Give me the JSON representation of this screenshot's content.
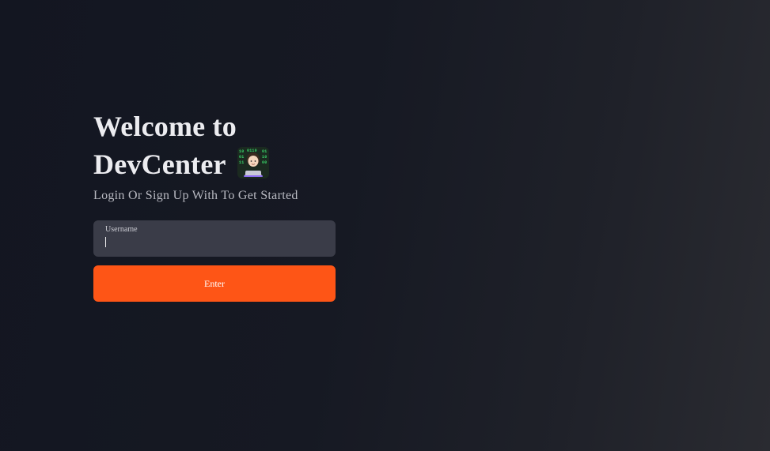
{
  "hero": {
    "title_line1": "Welcome to",
    "title_line2": "DevCenter",
    "title_icon": "technologist-emoji-icon",
    "subtitle": "Login Or Sign Up With To Get Started"
  },
  "form": {
    "username_label": "Username",
    "username_value": "",
    "submit_label": "Enter"
  },
  "colors": {
    "accent": "#fe5516",
    "input_bg": "#3a3c48",
    "background": "#151822"
  }
}
